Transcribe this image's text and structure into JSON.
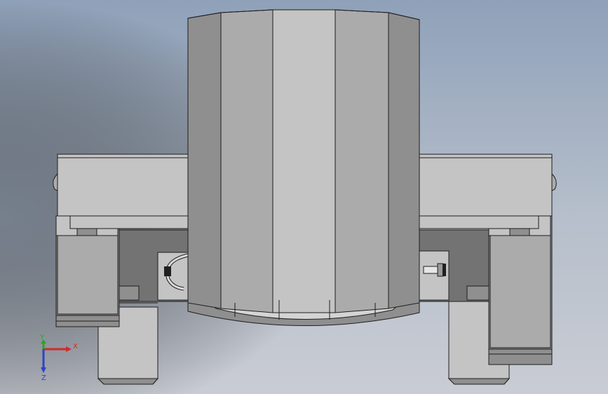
{
  "viewport": {
    "background_top": "#8fa1b9",
    "background_mid": "#b6bfcb",
    "background_bottom": "#c9ccd4",
    "shadow_left": "#6b7583"
  },
  "model_colors": {
    "light_face": "#c4c4c4",
    "mid_face": "#ababab",
    "dark_face": "#8f8f8f",
    "shadow_face": "#737373",
    "edge": "#1e1e1e"
  },
  "triad": {
    "x_label": "X",
    "y_label": "Y",
    "z_label": "Z",
    "x_color": "#d12a2a",
    "y_color": "#2aa32a",
    "z_color": "#2a44c9"
  }
}
